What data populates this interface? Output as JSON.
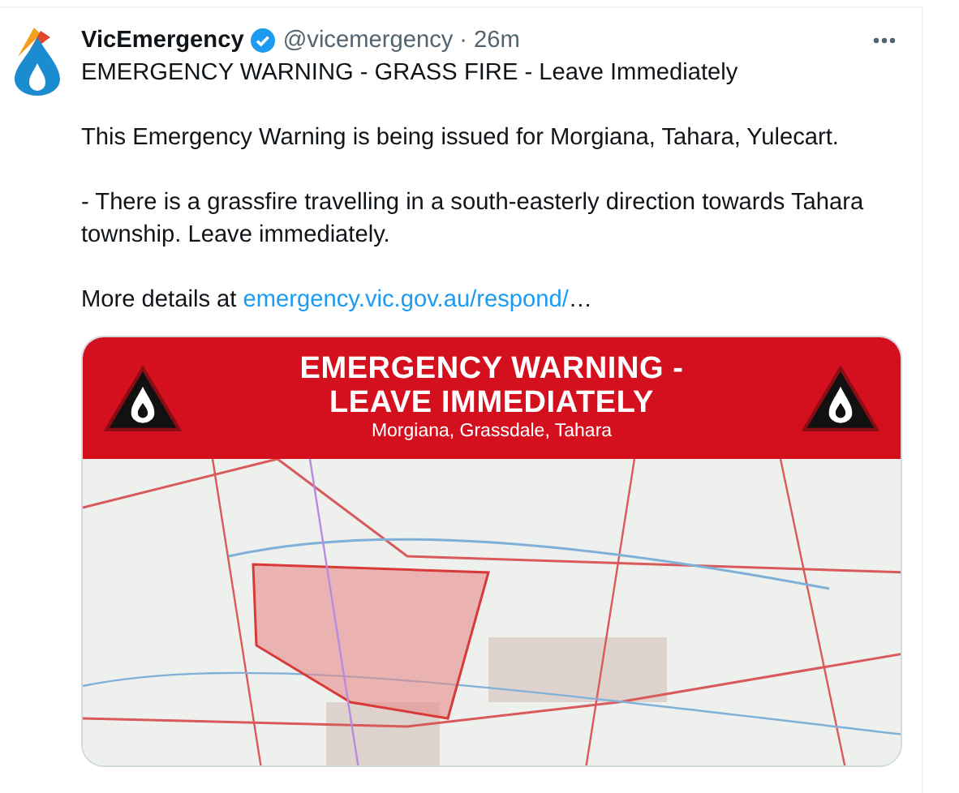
{
  "author": {
    "name": "VicEmergency",
    "verified": true,
    "handle": "@vicemergency",
    "separator": "·",
    "time": "26m"
  },
  "tweet": {
    "paragraphs": [
      {
        "text": "EMERGENCY WARNING - GRASS FIRE - Leave Immediately"
      },
      {
        "text": "This Emergency Warning is being issued for Morgiana, Tahara, Yulecart."
      },
      {
        "text": "- There is a grassfire travelling in a south-easterly direction towards Tahara township. Leave immediately."
      },
      {
        "text": "More details at ",
        "link": "emergency.vic.gov.au/respond/",
        "ellipsis": "…"
      }
    ]
  },
  "media": {
    "banner": {
      "title_lines": [
        "EMERGENCY WARNING -",
        "LEAVE IMMEDIATELY"
      ],
      "locations": "Morgiana, Grassdale, Tahara"
    }
  }
}
